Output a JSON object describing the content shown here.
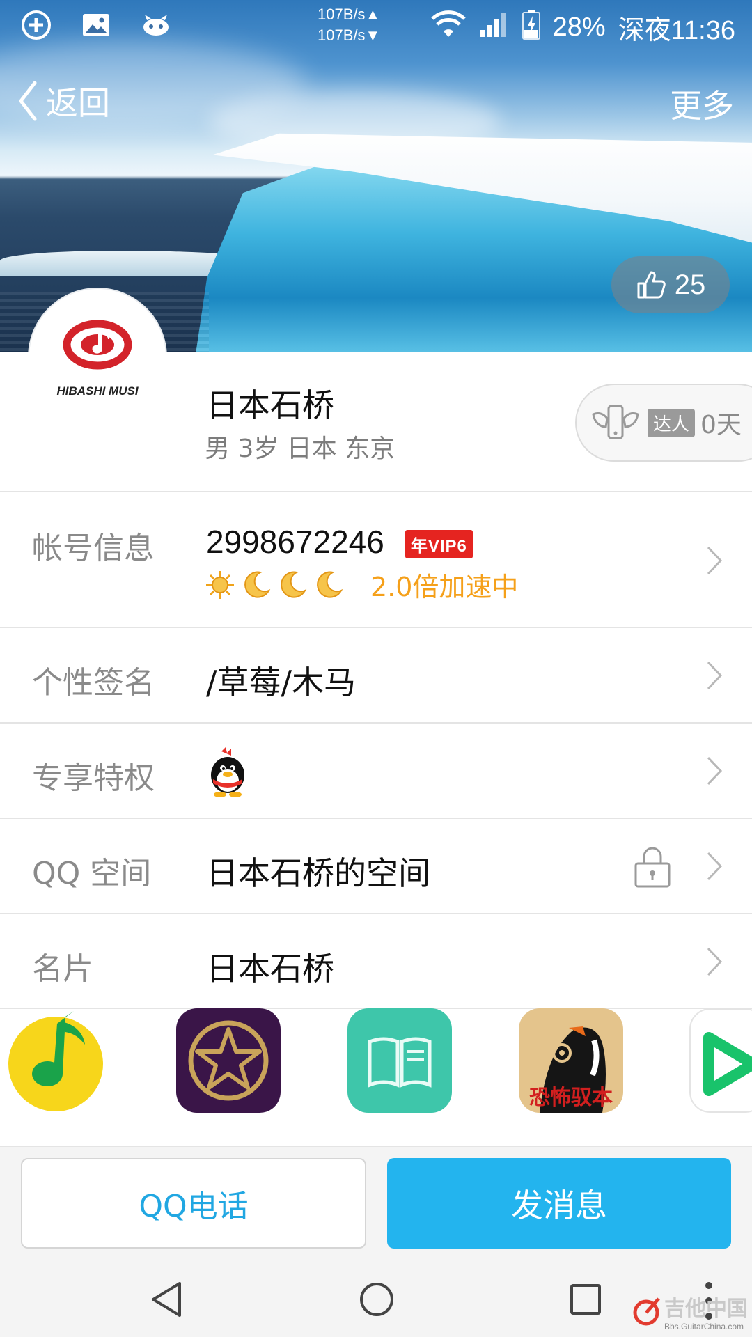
{
  "status_bar": {
    "net_up": "107B/s▲",
    "net_down": "107B/s▼",
    "battery": "28%",
    "time": "深夜11:36"
  },
  "nav": {
    "back_label": "返回",
    "more_label": "更多"
  },
  "hero": {
    "likes": "25"
  },
  "avatar": {
    "text": "HIBASHI MUSI"
  },
  "profile": {
    "name": "日本石桥",
    "meta": "男 3岁 日本 东京",
    "daren_badge": "达人",
    "daren_days": "0天"
  },
  "rows": {
    "account": {
      "label": "帐号信息",
      "qq": "2998672246",
      "vip": "年VIP6",
      "speed": "2.0倍加速中"
    },
    "signature": {
      "label": "个性签名",
      "value": "/草莓/木马"
    },
    "privilege": {
      "label": "专享特权"
    },
    "qzone": {
      "label": "QQ 空间",
      "value": "日本石桥的空间"
    },
    "card": {
      "label": "名片",
      "value": "日本石桥"
    }
  },
  "apps": [
    {
      "icon": "qq-music-icon"
    },
    {
      "icon": "qq-star-icon"
    },
    {
      "icon": "qq-reading-icon"
    },
    {
      "icon": "horror-game-icon",
      "text": "恐怖驭本"
    },
    {
      "icon": "video-play-icon"
    }
  ],
  "actions": {
    "call_label": "QQ电话",
    "message_label": "发消息"
  },
  "watermark": {
    "title": "吉他中国",
    "url": "Bbs.GuitarChina.com"
  },
  "colors": {
    "accent": "#23b4ee",
    "vip": "#e52420",
    "speed": "#f5a01a"
  }
}
